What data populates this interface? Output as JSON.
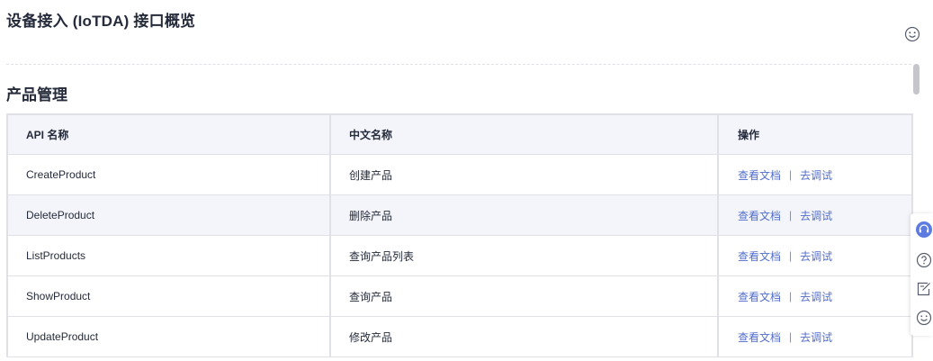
{
  "page": {
    "title": "设备接入 (IoTDA) 接口概览",
    "feedback_icon": "smile-icon"
  },
  "section": {
    "title": "产品管理"
  },
  "table": {
    "headers": [
      "API 名称",
      "中文名称",
      "操作"
    ],
    "rows": [
      {
        "api": "CreateProduct",
        "name": "创建产品",
        "doc": "查看文档",
        "sep": "|",
        "debug": "去调试"
      },
      {
        "api": "DeleteProduct",
        "name": "删除产品",
        "doc": "查看文档",
        "sep": "|",
        "debug": "去调试"
      },
      {
        "api": "ListProducts",
        "name": "查询产品列表",
        "doc": "查看文档",
        "sep": "|",
        "debug": "去调试"
      },
      {
        "api": "ShowProduct",
        "name": "查询产品",
        "doc": "查看文档",
        "sep": "|",
        "debug": "去调试"
      },
      {
        "api": "UpdateProduct",
        "name": "修改产品",
        "doc": "查看文档",
        "sep": "|",
        "debug": "去调试"
      }
    ]
  },
  "float_bar": {
    "icons": [
      "headset-icon",
      "help-icon",
      "edit-icon",
      "smile-icon"
    ]
  },
  "colors": {
    "link": "#526ecc",
    "header_bg": "#f3f5fa",
    "border": "#dfe1e6",
    "text": "#252b3a",
    "headset_accent": "#5e7ce0"
  }
}
